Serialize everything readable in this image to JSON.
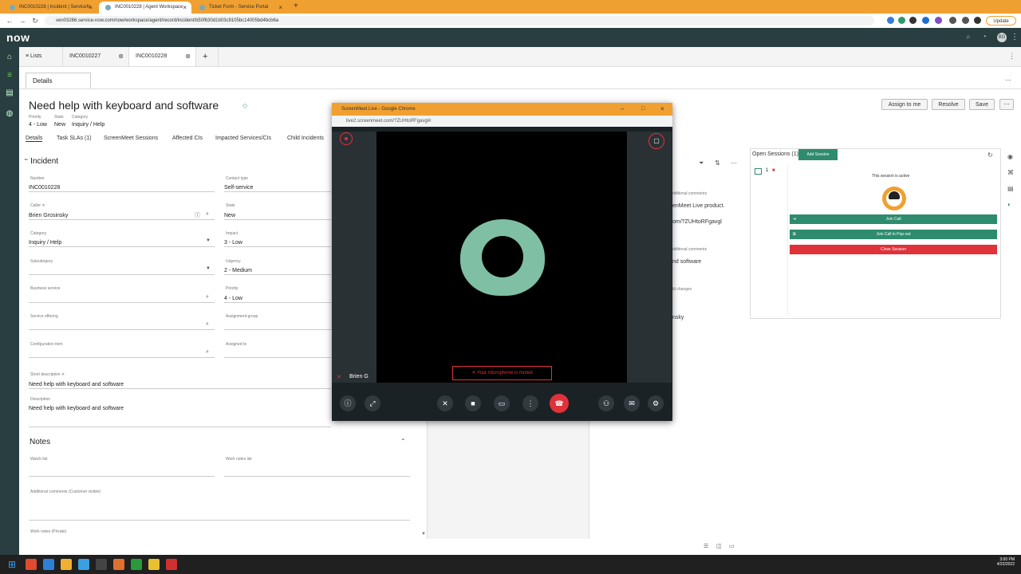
{
  "browser": {
    "tabs": [
      {
        "label": "INC0010228 | Incident | ServiceN"
      },
      {
        "label": "INC0010228 | Agent Workspace"
      },
      {
        "label": "Ticket Form - Service Portal"
      }
    ],
    "url": "ven03266.service-now.com/now/workspace/agent/record/incident/b50f630d1b03c9105bc14005bd4bcb6a",
    "update_label": "Update"
  },
  "header": {
    "logo": "now"
  },
  "workspace_tabs": [
    {
      "label": "Lists"
    },
    {
      "label": "INC0010227"
    },
    {
      "label": "INC0010228"
    }
  ],
  "record": {
    "details_tab": "Details",
    "title": "Need help with keyboard and software",
    "meta": [
      {
        "label": "Priority",
        "value": "4 - Low"
      },
      {
        "label": "State",
        "value": "New"
      },
      {
        "label": "Category",
        "value": "Inquiry / Help"
      }
    ],
    "actions": {
      "assign": "Assign to me",
      "resolve": "Resolve",
      "save": "Save"
    },
    "subtabs": [
      "Details",
      "Task SLAs (1)",
      "ScreenMeet Sessions",
      "Affected CIs",
      "Impacted Services/CIs",
      "Child Incidents"
    ],
    "section": "Incident",
    "fields": {
      "number_label": "Number",
      "number": "INC0010228",
      "contact_label": "Contact type",
      "contact": "Self-service",
      "caller_label": "Caller",
      "caller": "Brien Grosinsky",
      "state_label": "State",
      "state": "New",
      "category_label": "Category",
      "category": "Inquiry / Help",
      "impact_label": "Impact",
      "impact": "3 - Low",
      "subcategory_label": "Subcategory",
      "subcategory": "",
      "urgency_label": "Urgency",
      "urgency": "2 - Medium",
      "business_label": "Business service",
      "business": "",
      "priority_label": "Priority",
      "priority": "4 - Low",
      "offering_label": "Service offering",
      "offering": "",
      "group_label": "Assignment group",
      "group": "",
      "ci_label": "Configuration item",
      "ci": "",
      "assigned_label": "Assigned to",
      "assigned": "",
      "short_label": "Short description",
      "short": "Need help with keyboard and software",
      "desc_label": "Description",
      "desc": "Need help with keyboard and software"
    },
    "notes": {
      "title": "Notes",
      "watch_label": "Watch list",
      "worknotes_label": "Work notes list",
      "additional_label": "Additional comments (Customer visible)",
      "private_label": "Work notes (Private)"
    }
  },
  "activity": {
    "items": [
      {
        "sub": "dditional comments",
        "text": "enMeet Live product."
      },
      {
        "sub": "",
        "text": "om/?ZUHtoRFgavgl"
      },
      {
        "sub": "dditional comments",
        "text": "nd software"
      },
      {
        "sub": "ld changes",
        "text": "nsky"
      }
    ]
  },
  "screenmeet": {
    "open_sessions": "Open Sessions (1)",
    "add_session": "Add Session",
    "session_number": "1",
    "active_text": "This session is active",
    "join_call": "Join Call",
    "join_popout": "Join Call in Pop-out",
    "close_session": "Close Session",
    "colors": {
      "green": "#2e8b6e",
      "red": "#e0323a"
    }
  },
  "popup": {
    "window_title": "ScreenMeet Live - Google Chrome",
    "url": "live2.screenmeet.com/?ZUHtoRFgavgl#",
    "participant": "Brien G",
    "muted_text": "Your microphone is muted",
    "avatar_color": "#7fbfa4"
  },
  "taskbar": {
    "time": "3:00 PM",
    "date": "4/22/2022"
  }
}
